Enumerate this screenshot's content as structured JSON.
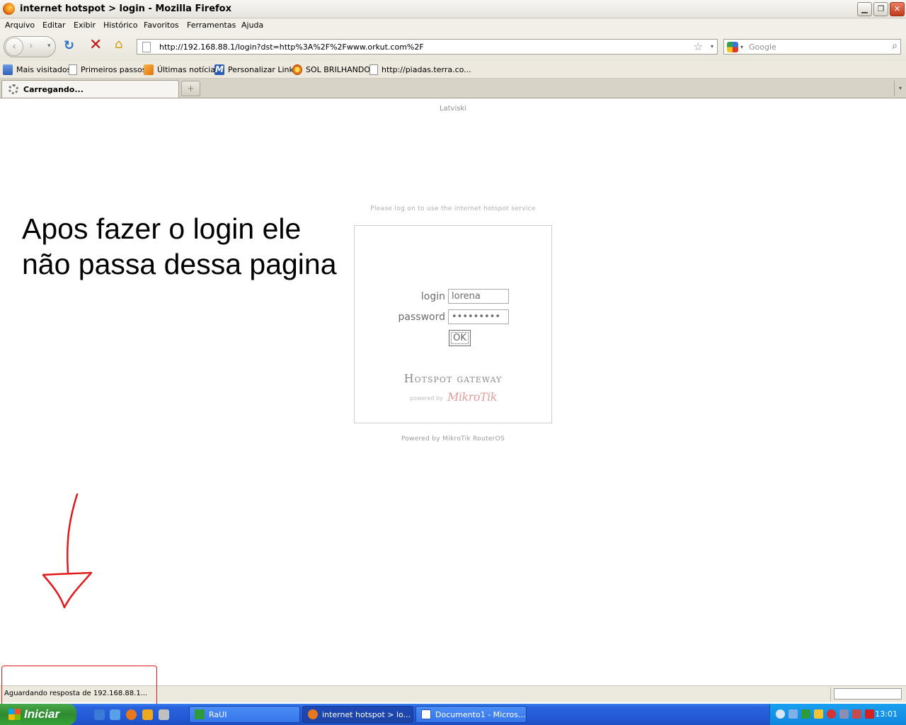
{
  "window": {
    "title": "internet hotspot > login - Mozilla Firefox",
    "controls": {
      "minimize": "▁",
      "restore": "❐",
      "close": "✕"
    }
  },
  "menu": [
    "Arquivo",
    "Editar",
    "Exibir",
    "Histórico",
    "Favoritos",
    "Ferramentas",
    "Ajuda"
  ],
  "nav": {
    "url": "http://192.168.88.1/login?dst=http%3A%2F%2Fwww.orkut.com%2F",
    "search_placeholder": "Google",
    "icons": {
      "back": "back-icon",
      "forward": "forward-icon",
      "reload": "reload-icon",
      "stop": "stop-icon",
      "home": "home-icon"
    }
  },
  "bookmarks": [
    {
      "label": "Mais visitados",
      "icon": "most-visited-icon"
    },
    {
      "label": "Primeiros passos",
      "icon": "page-icon"
    },
    {
      "label": "Últimas notícias",
      "icon": "rss-icon"
    },
    {
      "label": "Personalizar Links",
      "icon": "m-logo-icon"
    },
    {
      "label": "SOL BRILHANDO",
      "icon": "sun-icon"
    },
    {
      "label": "http://piadas.terra.co...",
      "icon": "page-icon"
    }
  ],
  "tabs": [
    {
      "label": "Carregando..."
    }
  ],
  "page": {
    "language_link": "Latviski",
    "annotation": "Apos fazer o login ele não passa dessa pagina",
    "prompt": "Please log on to use the internet hotspot service",
    "login_label": "login",
    "login_value": "lorena",
    "password_label": "password",
    "password_value": "lorena123",
    "ok_label": "OK",
    "brand": "Hotspot gateway",
    "powered_by": "powered by",
    "mikrotik": "MikroTik",
    "footer": "Powered by MikroTik RouterOS"
  },
  "status": {
    "text": "Aguardando resposta de 192.168.88.1..."
  },
  "taskbar": {
    "start_label": "Iniciar",
    "buttons": [
      {
        "label": "RaUI",
        "active": false
      },
      {
        "label": "internet hotspot > lo...",
        "active": true
      },
      {
        "label": "Documento1 - Micros...",
        "active": false
      }
    ],
    "clock": "13:01"
  },
  "colors": {
    "annotation_red": "#e01a1a",
    "taskbar_blue": "#245ad6"
  }
}
